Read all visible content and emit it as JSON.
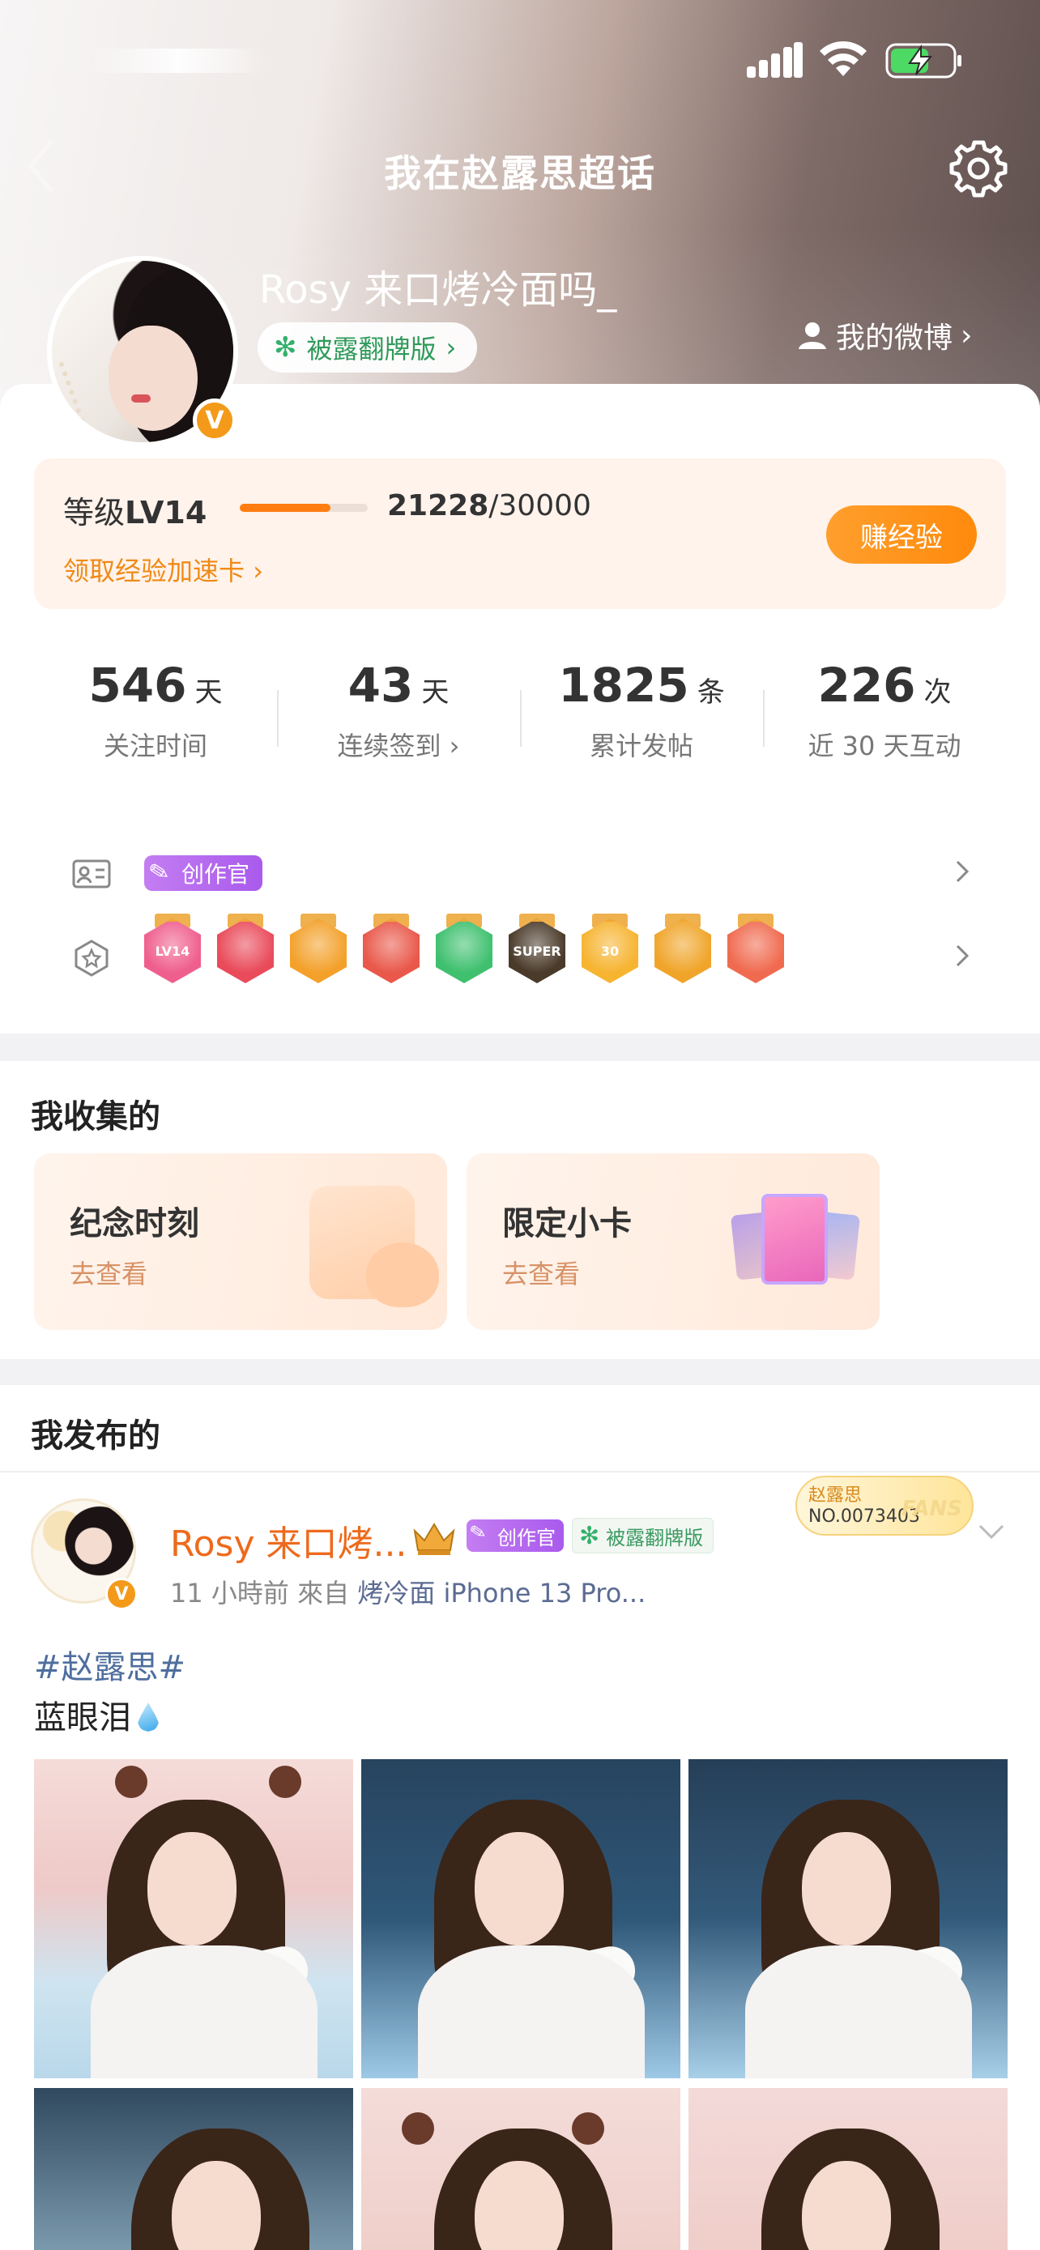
{
  "header": {
    "title": "我在赵露思超话"
  },
  "profile": {
    "username": "Rosy 来口烤冷面吗_",
    "fan_tag": "被露翻牌版",
    "my_weibo": "我的微博",
    "verified_mark": "V"
  },
  "level": {
    "prefix": "等级",
    "level": "LV14",
    "current": "21228",
    "total": "/30000",
    "progress_fraction": 0.7076,
    "link": "领取经验加速卡",
    "earn_button": "赚经验"
  },
  "stats": [
    {
      "value": "546",
      "unit": "天",
      "label": "关注时间"
    },
    {
      "value": "43",
      "unit": "天",
      "label": "连续签到 ›"
    },
    {
      "value": "1825",
      "unit": "条",
      "label": "累计发帖"
    },
    {
      "value": "226",
      "unit": "次",
      "label": "近 30 天互动"
    }
  ],
  "badges": {
    "creator_tag": "创作官",
    "items": [
      {
        "name": "lv14-badge",
        "text": "LV14",
        "color": "#ef5f8e"
      },
      {
        "name": "trophy-badge",
        "text": "",
        "color": "#e94b5a"
      },
      {
        "name": "crown-badge",
        "text": "",
        "color": "#f3a12b"
      },
      {
        "name": "mascot-badge",
        "text": "",
        "color": "#e9584a"
      },
      {
        "name": "hand-badge",
        "text": "",
        "color": "#3fc06f"
      },
      {
        "name": "super-badge",
        "text": "SUPER",
        "color": "#4a3a2a"
      },
      {
        "name": "30-days-badge",
        "text": "30",
        "color": "#f6b431"
      },
      {
        "name": "laugh-badge",
        "text": "",
        "color": "#f0a52a"
      },
      {
        "name": "rock-hand-badge",
        "text": "",
        "color": "#f06a4f"
      }
    ]
  },
  "collected": {
    "title": "我收集的",
    "cards": [
      {
        "title": "纪念时刻",
        "sub": "去查看"
      },
      {
        "title": "限定小卡",
        "sub": "去查看"
      }
    ]
  },
  "published": {
    "title": "我发布的",
    "post": {
      "author": "Rosy 来口烤...",
      "creator_tag": "创作官",
      "fan_tag": "被露翻牌版",
      "fans_name": "赵露思",
      "fans_no": "NO.0073403",
      "fans_deco": "FANS",
      "time": "11 小時前",
      "from_label": "來自",
      "source": "烤冷面 iPhone 13 Pro...",
      "hashtag": "#赵露思#",
      "text": "蓝眼泪"
    }
  }
}
